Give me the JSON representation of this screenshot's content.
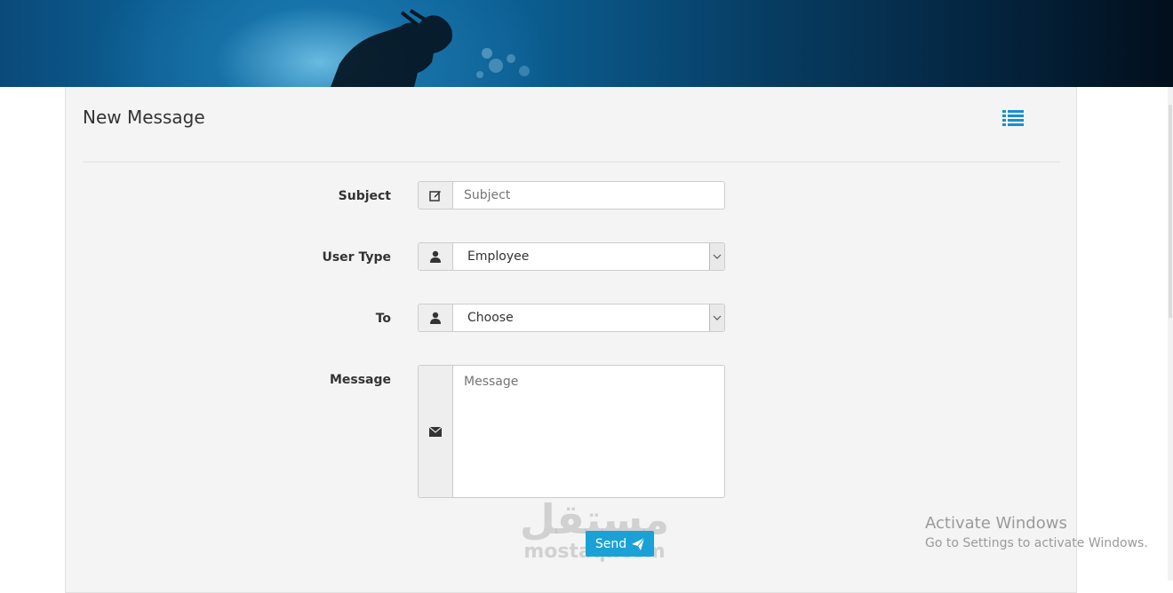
{
  "panel": {
    "title": "New Message",
    "list_icon": "list-icon"
  },
  "form": {
    "subject": {
      "label": "Subject",
      "placeholder": "Subject",
      "icon": "edit-icon"
    },
    "user_type": {
      "label": "User Type",
      "value": "Employee",
      "icon": "user-icon"
    },
    "to": {
      "label": "To",
      "value": "Choose",
      "icon": "user-icon"
    },
    "message": {
      "label": "Message",
      "placeholder": "Message",
      "icon": "envelope-icon"
    },
    "send_label": "Send",
    "send_icon": "paper-plane-icon"
  },
  "watermark": {
    "arabic": "مستقل",
    "latin": "mostaql.com"
  },
  "os_notice": {
    "title": "Activate Windows",
    "subtitle": "Go to Settings to activate Windows."
  },
  "colors": {
    "accent": "#1aa1d6",
    "panel_bg": "#f4f4f4"
  }
}
